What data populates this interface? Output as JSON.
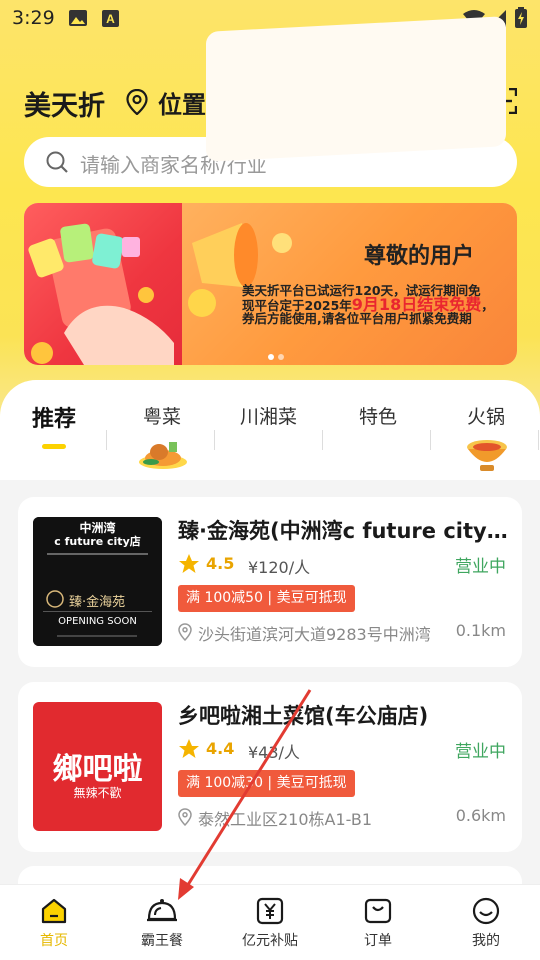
{
  "status_bar": {
    "time": "3:29"
  },
  "header": {
    "brand": "美天折",
    "location_text": "位置获取失败"
  },
  "search": {
    "placeholder": "请输入商家名称/行业"
  },
  "banner": {
    "title": "尊敬的用户",
    "line1": "美天折平台已试运行120天，试运行期间免",
    "line2_prefix": "现平台定于2025年",
    "line2_red": "9月18日结束免费",
    "line2_suffix": "，",
    "line3": "券后方能使用,请各位平台用户抓紧免费期"
  },
  "categories": [
    {
      "label": "推荐",
      "active": true
    },
    {
      "label": "粤菜",
      "active": false
    },
    {
      "label": "川湘菜",
      "active": false
    },
    {
      "label": "特色",
      "active": false
    },
    {
      "label": "火锅",
      "active": false
    }
  ],
  "restaurants": [
    {
      "name": "臻·金海苑(中洲湾c future city店)",
      "rating": "4.5",
      "price": "¥120/人",
      "status": "营业中",
      "promo": "满 100减50 | 美豆可抵现",
      "address": "沙头街道滨河大道9283号中洲湾",
      "distance": "0.1km",
      "thumb_line1": "中洲湾",
      "thumb_line2": "c future city店",
      "thumb_line3": "臻·金海苑",
      "thumb_line4": "OPENING SOON"
    },
    {
      "name": "乡吧啦湘土菜馆(车公庙店)",
      "rating": "4.4",
      "price": "¥43/人",
      "status": "营业中",
      "promo": "满 100减30 | 美豆可抵现",
      "address": "泰然工业区210栋A1-B1",
      "distance": "0.6km",
      "thumb_line1": "鄉吧啦",
      "thumb_line2": "無辣不歡"
    }
  ],
  "bottom_nav": [
    {
      "label": "首页",
      "icon": "home-icon",
      "active": true
    },
    {
      "label": "霸王餐",
      "icon": "dish-cover-icon",
      "active": false
    },
    {
      "label": "亿元补贴",
      "icon": "yuan-icon",
      "active": false
    },
    {
      "label": "订单",
      "icon": "order-bag-icon",
      "active": false
    },
    {
      "label": "我的",
      "icon": "smile-icon",
      "active": false
    }
  ],
  "colors": {
    "brand_yellow": "#fde650",
    "accent_yellow": "#fcd200",
    "promo_red": "#f05a3c",
    "open_green": "#3fa65f",
    "arrow_red": "#e23b32"
  }
}
